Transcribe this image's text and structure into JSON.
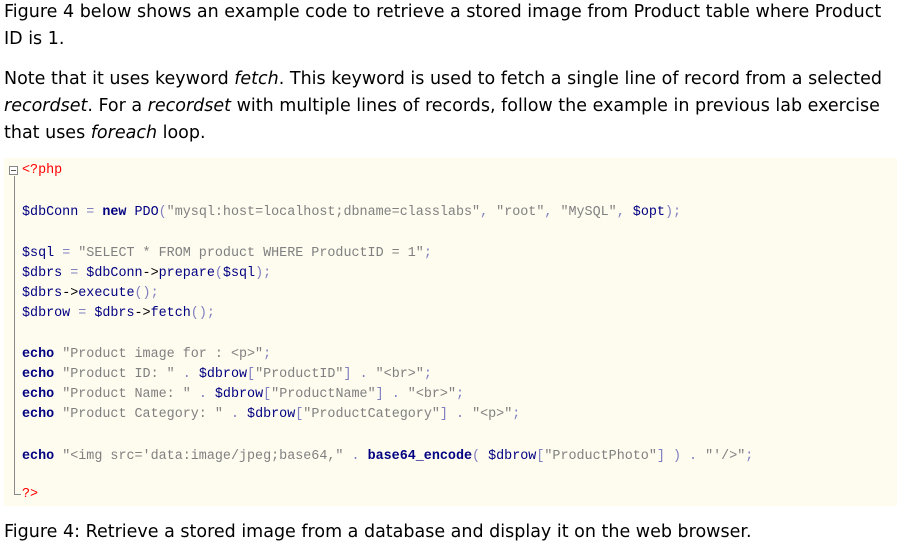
{
  "intro": {
    "p1": "Figure 4 below shows an example code to retrieve a stored image from Product table where Product ID is 1.",
    "p2": {
      "t1": "Note that it uses keyword ",
      "kw1": "fetch",
      "t2": ". This keyword is used to fetch a single line of record from a selected ",
      "kw2": "recordset",
      "t3": ". For a ",
      "kw3": "recordset",
      "t4": " with multiple lines of records, follow the example in previous lab exercise that uses ",
      "kw4": "foreach",
      "t5": " loop."
    }
  },
  "code": {
    "open": "<?php",
    "l1": {
      "a": "$dbConn",
      "b": " = ",
      "c": "new",
      "d": " PDO",
      "e": "(",
      "f": "\"mysql:host=localhost;dbname=classlabs\"",
      "g": ", ",
      "h": "\"root\"",
      "i": ", ",
      "j": "\"MySQL\"",
      "k": ", ",
      "l": "$opt",
      "m": ");"
    },
    "l2": {
      "a": "$sql",
      "b": " = ",
      "c": "\"SELECT * FROM product WHERE ProductID = 1\"",
      "d": ";"
    },
    "l3": {
      "a": "$dbrs",
      "b": " = ",
      "c": "$dbConn",
      "d": "->",
      "e": "prepare",
      "f": "(",
      "g": "$sql",
      "h": ");"
    },
    "l4": {
      "a": "$dbrs",
      "b": "->",
      "c": "execute",
      "d": "();"
    },
    "l5": {
      "a": "$dbrow",
      "b": " = ",
      "c": "$dbrs",
      "d": "->",
      "e": "fetch",
      "f": "();"
    },
    "l6": {
      "a": "echo",
      "b": " ",
      "c": "\"Product image for : <p>\"",
      "d": ";"
    },
    "l7": {
      "a": "echo",
      "b": " ",
      "c": "\"Product ID: \"",
      "d": " . ",
      "e": "$dbrow",
      "f": "[",
      "g": "\"ProductID\"",
      "h": "]",
      "i": " . ",
      "j": "\"<br>\"",
      "k": ";"
    },
    "l8": {
      "a": "echo",
      "b": " ",
      "c": "\"Product Name: \"",
      "d": " . ",
      "e": "$dbrow",
      "f": "[",
      "g": "\"ProductName\"",
      "h": "]",
      "i": " . ",
      "j": "\"<br>\"",
      "k": ";"
    },
    "l9": {
      "a": "echo",
      "b": " ",
      "c": "\"Product Category: \"",
      "d": " . ",
      "e": "$dbrow",
      "f": "[",
      "g": "\"ProductCategory\"",
      "h": "]",
      "i": " . ",
      "j": "\"<p>\"",
      "k": ";"
    },
    "l10": {
      "a": "echo",
      "b": " ",
      "c": "\"<img src='data:image/jpeg;base64,\"",
      "d": " . ",
      "e": "base64_encode",
      "f": "( ",
      "g": "$dbrow",
      "h": "[",
      "i": "\"ProductPhoto\"",
      "j": "]",
      "k": " ) . ",
      "l": "\"'/>\"",
      "m": ";"
    },
    "close": "?>"
  },
  "caption": "Figure 4: Retrieve a stored image from a database and display it on the web browser."
}
